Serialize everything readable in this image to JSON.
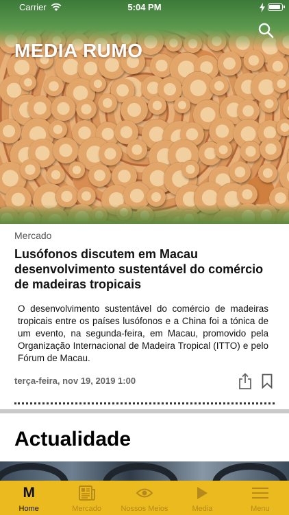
{
  "status_bar": {
    "carrier": "Carrier",
    "time": "5:04 PM"
  },
  "header": {
    "brand": "MEDIA RUMO"
  },
  "featured": {
    "category": "Mercado",
    "headline": "Lusófonos discutem em Macau desenvolvimento sustentável do comércio de madeiras tropicais",
    "summary": "O desenvolvimento sustentável do comércio de madeiras tropicais entre os países lusófonos e a China foi a tónica de um evento, na segunda-feira, em Macau, promovido pela Organização Internacional de Madeira Tropical (ITTO) e pelo Fórum de Macau.",
    "date": "terça-feira, nov 19, 2019 1:00"
  },
  "section": {
    "title": "Actualidade"
  },
  "tab_bar": {
    "active_tab": "Home",
    "tabs": [
      {
        "label": "Home",
        "icon": "m-logo-icon"
      },
      {
        "label": "Mercado",
        "icon": "newspaper-icon"
      },
      {
        "label": "Nossos Meios",
        "icon": "eye-icon"
      },
      {
        "label": "Media",
        "icon": "play-icon"
      },
      {
        "label": "Menu",
        "icon": "hamburger-icon"
      }
    ]
  },
  "colors": {
    "tab_bar": "#ebba1e",
    "tab_inactive": "#b5891b",
    "tab_active": "#111111"
  }
}
